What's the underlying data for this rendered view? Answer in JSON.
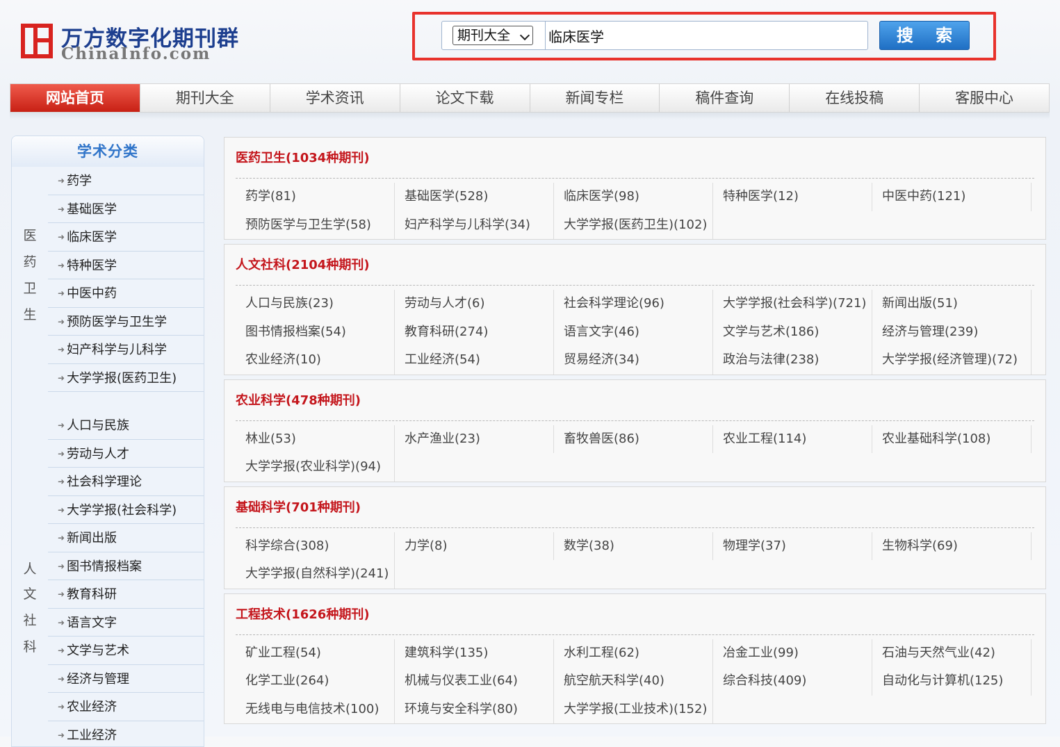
{
  "header": {
    "logo_cn": "万方数字化期刊群",
    "logo_en": "ChinaInfo.com"
  },
  "search": {
    "category": "期刊大全",
    "query": "临床医学",
    "button_label": "搜 索"
  },
  "nav": {
    "items": [
      "网站首页",
      "期刊大全",
      "学术资讯",
      "论文下载",
      "新闻专栏",
      "稿件查询",
      "在线投稿",
      "客服中心"
    ],
    "active_index": 0
  },
  "sidebar": {
    "title": "学术分类",
    "groups": [
      {
        "label": [
          "医",
          "药",
          "卫",
          "生"
        ],
        "items": [
          "药学",
          "基础医学",
          "临床医学",
          "特种医学",
          "中医中药",
          "预防医学与卫生学",
          "妇产科学与儿科学",
          "大学学报(医药卫生)"
        ]
      },
      {
        "label": [
          "人",
          "文",
          "社",
          "科"
        ],
        "items": [
          "人口与民族",
          "劳动与人才",
          "社会科学理论",
          "大学学报(社会科学)",
          "新闻出版",
          "图书情报档案",
          "教育科研",
          "语言文字",
          "文学与艺术",
          "经济与管理",
          "农业经济",
          "工业经济"
        ]
      }
    ]
  },
  "sections": [
    {
      "title": "医药卫生(1034种期刊)",
      "items": [
        "药学(81)",
        "基础医学(528)",
        "临床医学(98)",
        "特种医学(12)",
        "中医中药(121)",
        "预防医学与卫生学(58)",
        "妇产科学与儿科学(34)",
        "大学学报(医药卫生)(102)"
      ]
    },
    {
      "title": "人文社科(2104种期刊)",
      "items": [
        "人口与民族(23)",
        "劳动与人才(6)",
        "社会科学理论(96)",
        "大学学报(社会科学)(721)",
        "新闻出版(51)",
        "图书情报档案(54)",
        "教育科研(274)",
        "语言文字(46)",
        "文学与艺术(186)",
        "经济与管理(239)",
        "农业经济(10)",
        "工业经济(54)",
        "贸易经济(34)",
        "政治与法律(238)",
        "大学学报(经济管理)(72)"
      ]
    },
    {
      "title": "农业科学(478种期刊)",
      "items": [
        "林业(53)",
        "水产渔业(23)",
        "畜牧兽医(86)",
        "农业工程(114)",
        "农业基础科学(108)",
        "大学学报(农业科学)(94)"
      ]
    },
    {
      "title": "基础科学(701种期刊)",
      "items": [
        "科学综合(308)",
        "力学(8)",
        "数学(38)",
        "物理学(37)",
        "生物科学(69)",
        "大学学报(自然科学)(241)"
      ]
    },
    {
      "title": "工程技术(1626种期刊)",
      "items": [
        "矿业工程(54)",
        "建筑科学(135)",
        "水利工程(62)",
        "冶金工业(99)",
        "石油与天然气业(42)",
        "化学工业(264)",
        "机械与仪表工业(64)",
        "航空航天科学(40)",
        "综合科技(409)",
        "自动化与计算机(125)",
        "无线电与电信技术(100)",
        "环境与安全科学(80)",
        "大学学报(工业技术)(152)"
      ]
    }
  ]
}
